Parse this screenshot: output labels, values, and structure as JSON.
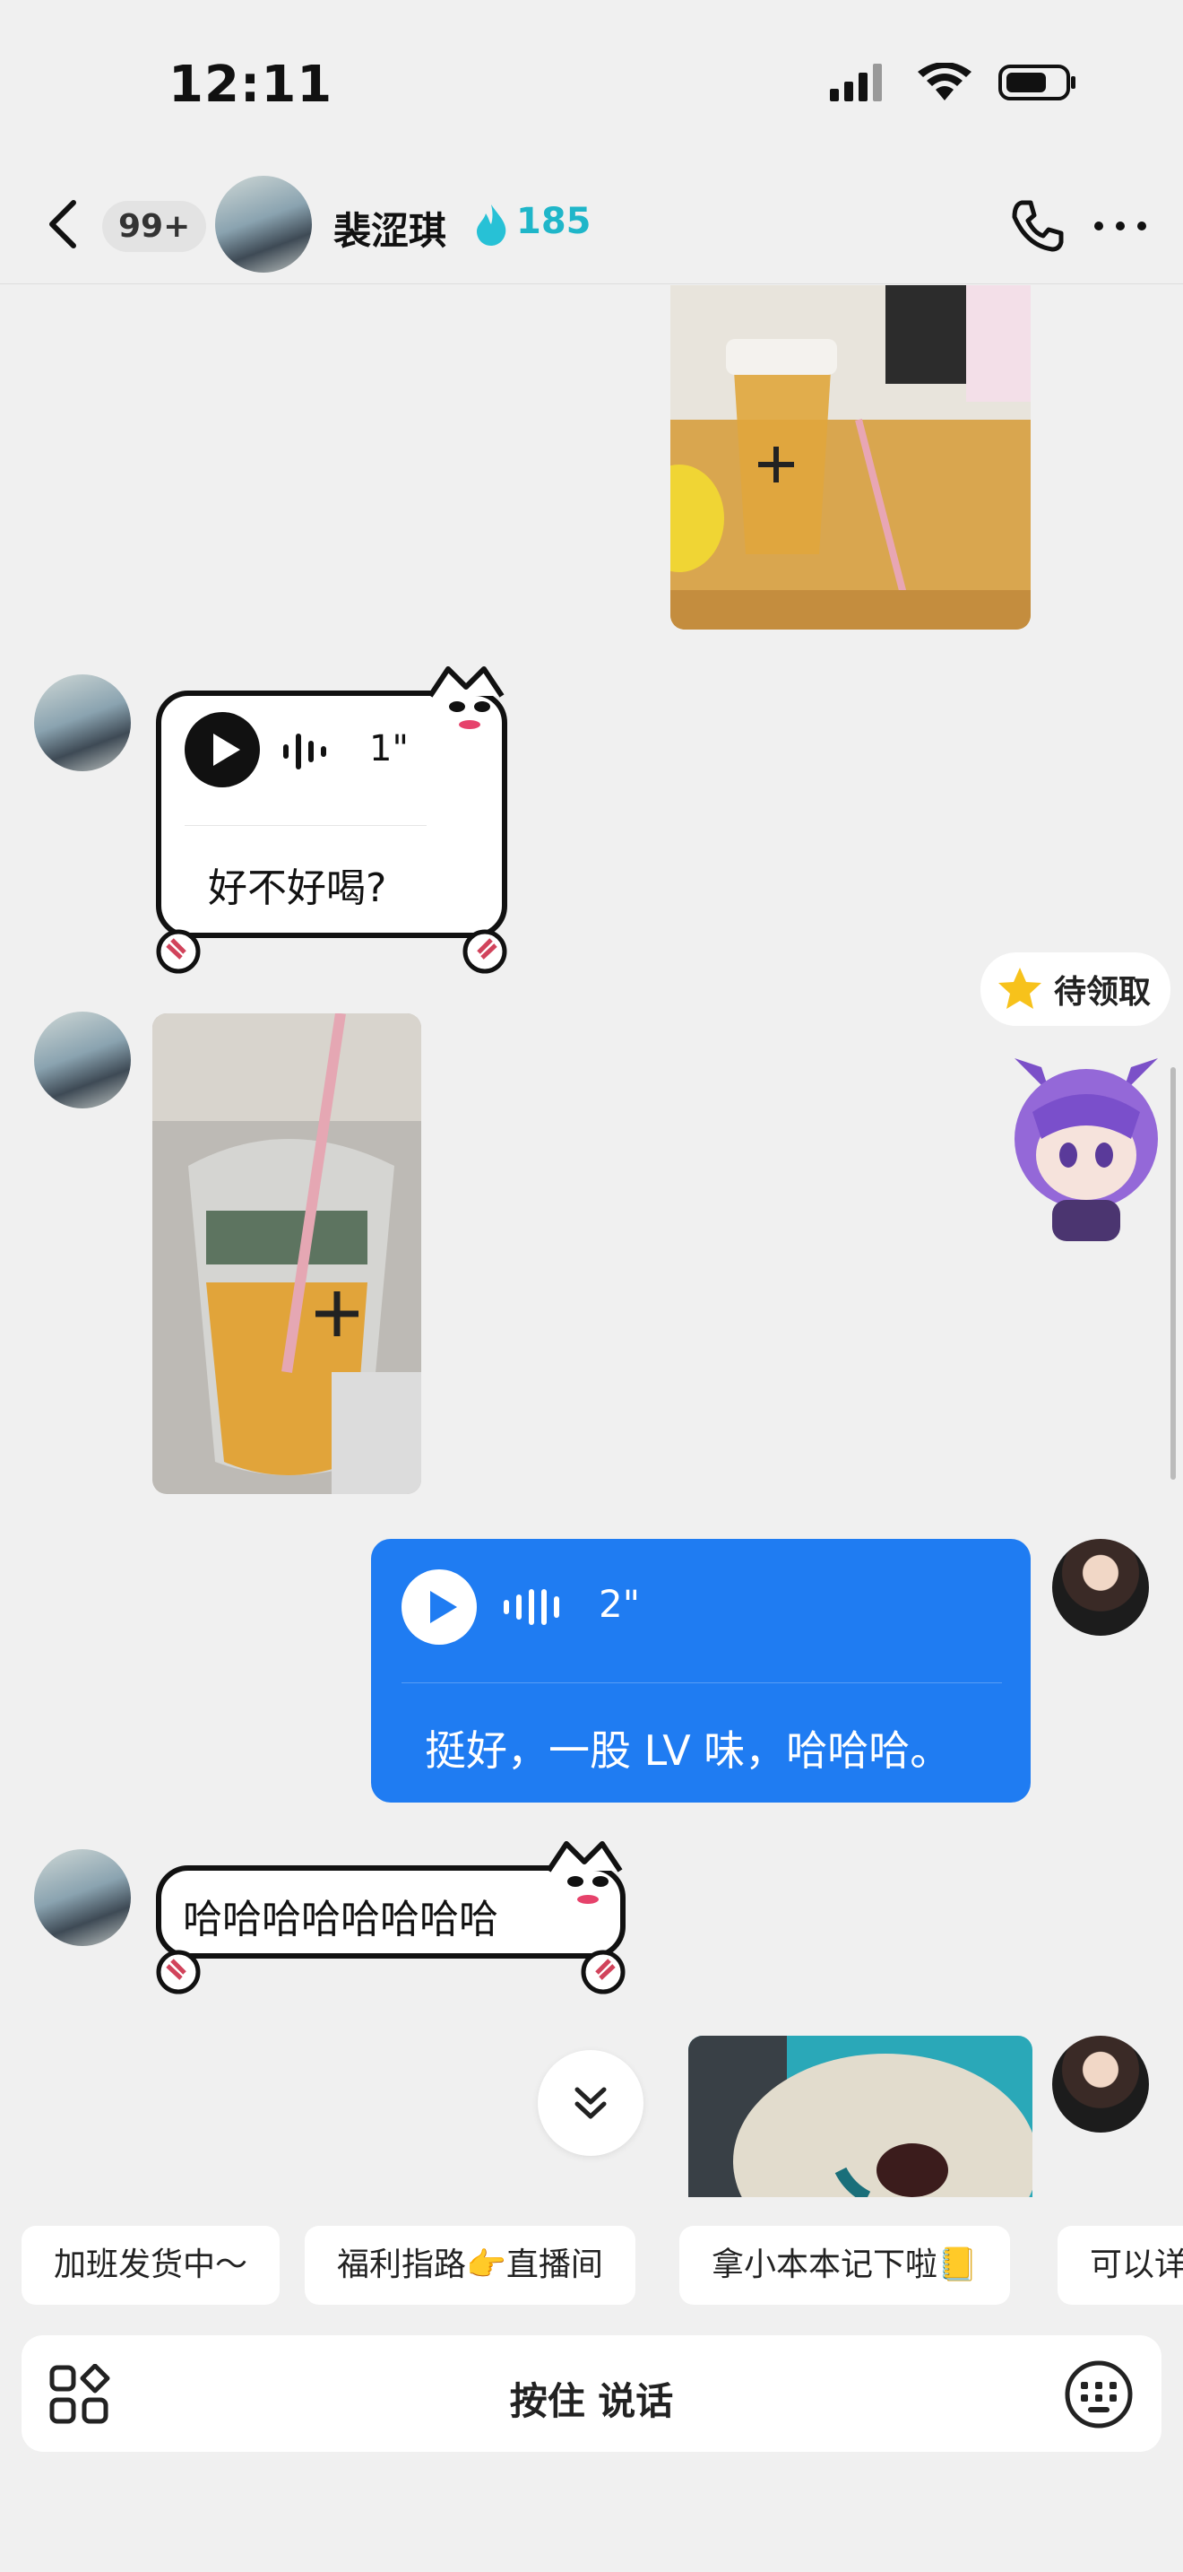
{
  "status_bar": {
    "time": "12:11"
  },
  "header": {
    "unread_badge": "99+",
    "contact_name": "裴涩琪",
    "streak_count": "185"
  },
  "messages": [
    {
      "from": "them",
      "type": "voice",
      "duration": "1\"",
      "transcript": "好不好喝?"
    },
    {
      "from": "me",
      "type": "voice",
      "duration": "2\"",
      "transcript": "挺好，一股 LV 味，哈哈哈。"
    },
    {
      "from": "them",
      "type": "text",
      "text": "哈哈哈哈哈哈哈哈"
    }
  ],
  "pending_reward": {
    "label": "待领取"
  },
  "quick_replies": [
    "加班发货中～",
    "福利指路👉直播间",
    "拿小本本记下啦📒",
    "可以详"
  ],
  "input_bar": {
    "hold_to_talk": "按住 说话"
  },
  "colors": {
    "accent_blue": "#1f7cf2",
    "streak_teal": "#1fb6c9"
  }
}
